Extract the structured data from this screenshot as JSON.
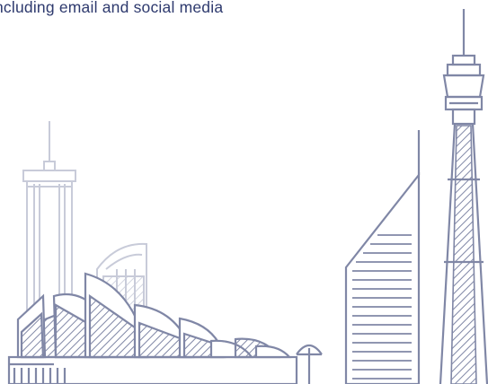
{
  "caption": "ncluding email and social media",
  "colors": {
    "text": "#2e3a6e",
    "line_dark": "#8087a6",
    "line_light": "#c8cbd9"
  },
  "illustration": {
    "subject": "Sydney skyline line art",
    "icons": [
      "sydney-tower-icon",
      "opera-house-icon",
      "office-tower-icon",
      "street-lamp-icon"
    ]
  }
}
